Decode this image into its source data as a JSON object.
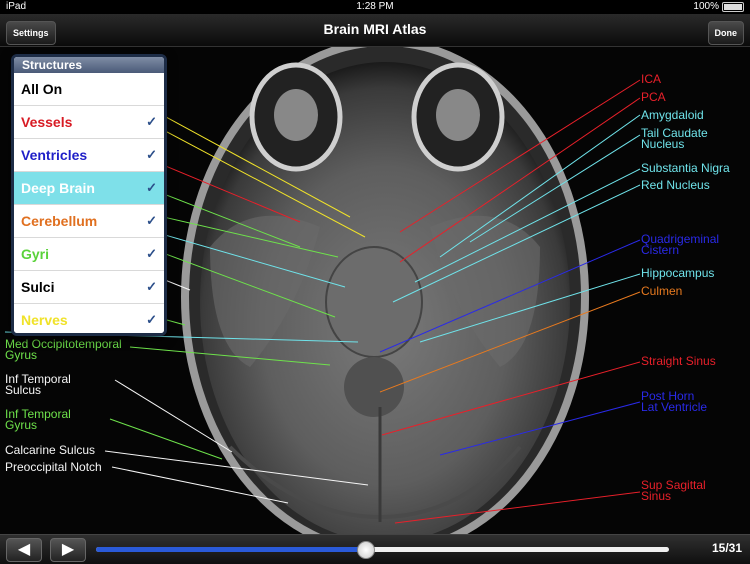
{
  "status_bar": {
    "left": "iPad",
    "time": "1:28 PM",
    "battery": "100%"
  },
  "nav": {
    "title": "Brain MRI Atlas",
    "settings_label": "Settings",
    "done_label": "Done"
  },
  "popover": {
    "title": "Structures",
    "items": [
      {
        "label": "All On",
        "checked": false,
        "color": "#000000"
      },
      {
        "label": "Vessels",
        "checked": true,
        "color": "#d81b24"
      },
      {
        "label": "Ventricles",
        "checked": true,
        "color": "#1f1fc8"
      },
      {
        "label": "Deep Brain",
        "checked": true,
        "color": "#ffffff"
      },
      {
        "label": "Cerebellum",
        "checked": true,
        "color": "#e07020"
      },
      {
        "label": "Gyri",
        "checked": true,
        "color": "#5ad23a"
      },
      {
        "label": "Sulci",
        "checked": true,
        "color": "#000000"
      },
      {
        "label": "Nerves",
        "checked": true,
        "color": "#f0e229"
      }
    ]
  },
  "labels_right": [
    {
      "text": "ICA",
      "class": "c-red"
    },
    {
      "text": "PCA",
      "class": "c-red"
    },
    {
      "text": "Amygdaloid",
      "class": "c-cyan"
    },
    {
      "text": "Tail Caudate\nNucleus",
      "class": "c-cyan"
    },
    {
      "text": "Substantia Nigra",
      "class": "c-cyan"
    },
    {
      "text": "Red Nucleus",
      "class": "c-cyan"
    },
    {
      "text": "Quadrigeminal\nCistern",
      "class": "c-blue"
    },
    {
      "text": "Hippocampus",
      "class": "c-cyan"
    },
    {
      "text": "Culmen",
      "class": "c-orange"
    },
    {
      "text": "Straight Sinus",
      "class": "c-red"
    },
    {
      "text": "Post Horn\nLat Ventricle",
      "class": "c-blue"
    },
    {
      "text": "Sup Sagittal\nSinus",
      "class": "c-red"
    }
  ],
  "labels_left": [
    {
      "text": "Med Occipitotemporal\nGyrus",
      "class": "c-green"
    },
    {
      "text": "Inf Temporal\nSulcus",
      "class": "c-white"
    },
    {
      "text": "Inf Temporal\nGyrus",
      "class": "c-green"
    },
    {
      "text": "Calcarine Sulcus",
      "class": "c-white"
    },
    {
      "text": "Preoccipital Notch",
      "class": "c-white"
    }
  ],
  "bottom": {
    "prev_symbol": "◀",
    "next_symbol": "▶",
    "page_label": "15/31",
    "progress": 0.47
  }
}
